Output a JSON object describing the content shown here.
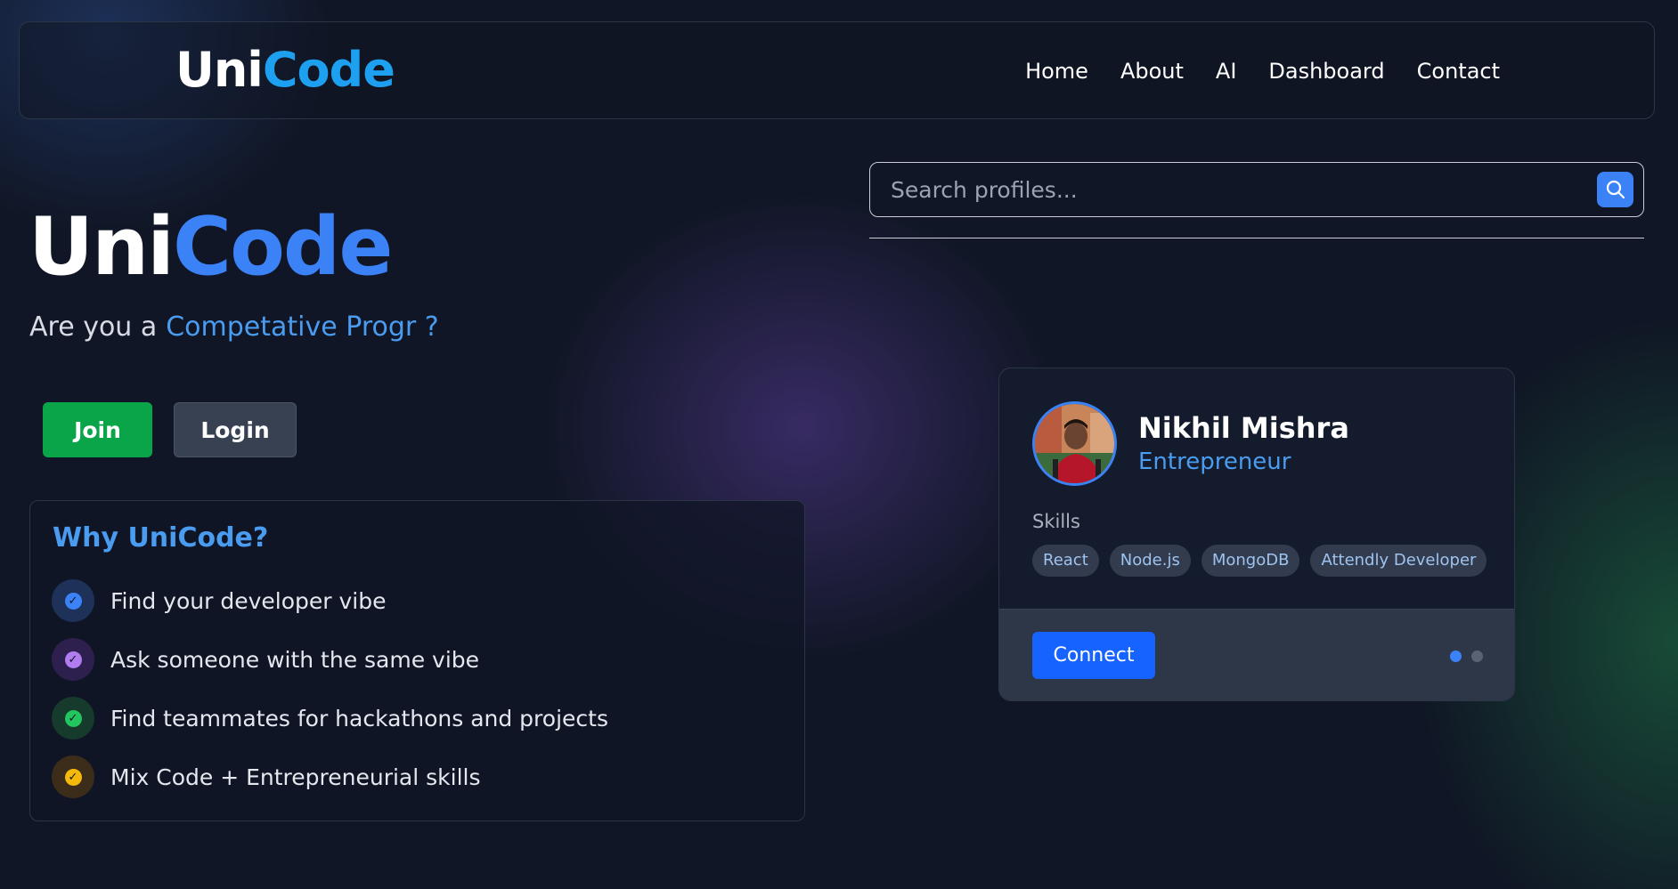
{
  "nav": {
    "logo_part1": "Uni",
    "logo_part2": "Code",
    "links": [
      "Home",
      "About",
      "AI",
      "Dashboard",
      "Contact"
    ]
  },
  "hero": {
    "title_part1": "Uni",
    "title_part2": "Code",
    "tagline_prefix": "Are you a",
    "tagline_rotating": "Competative Progr ?",
    "join_label": "Join",
    "login_label": "Login"
  },
  "why": {
    "title": "Why UniCode?",
    "items": [
      {
        "text": "Find your developer vibe",
        "icon": "check-circle-icon",
        "color": "#3b82f6",
        "bg": "#1e3158"
      },
      {
        "text": "Ask someone with the same vibe",
        "icon": "check-circle-icon",
        "color": "#b07cf0",
        "bg": "#2d1f4e"
      },
      {
        "text": "Find teammates for hackathons and projects",
        "icon": "check-circle-icon",
        "color": "#22c55e",
        "bg": "#163a2b"
      },
      {
        "text": "Mix Code + Entrepreneurial skills",
        "icon": "check-circle-icon",
        "color": "#f5b90b",
        "bg": "#3c2d1a"
      }
    ]
  },
  "search": {
    "placeholder": "Search profiles...",
    "icon": "search-icon"
  },
  "profile": {
    "name": "Nikhil Mishra",
    "role": "Entrepreneur",
    "skills_label": "Skills",
    "skills": [
      "React",
      "Node.js",
      "MongoDB",
      "Attendly Developer"
    ],
    "connect_label": "Connect",
    "carousel_active_index": 0,
    "carousel_count": 2
  },
  "colors": {
    "accent": "#3b82f6",
    "join": "#09a548",
    "connect": "#1663ff",
    "dot_active": "#3b82f6",
    "dot_inactive": "#5a6373"
  }
}
